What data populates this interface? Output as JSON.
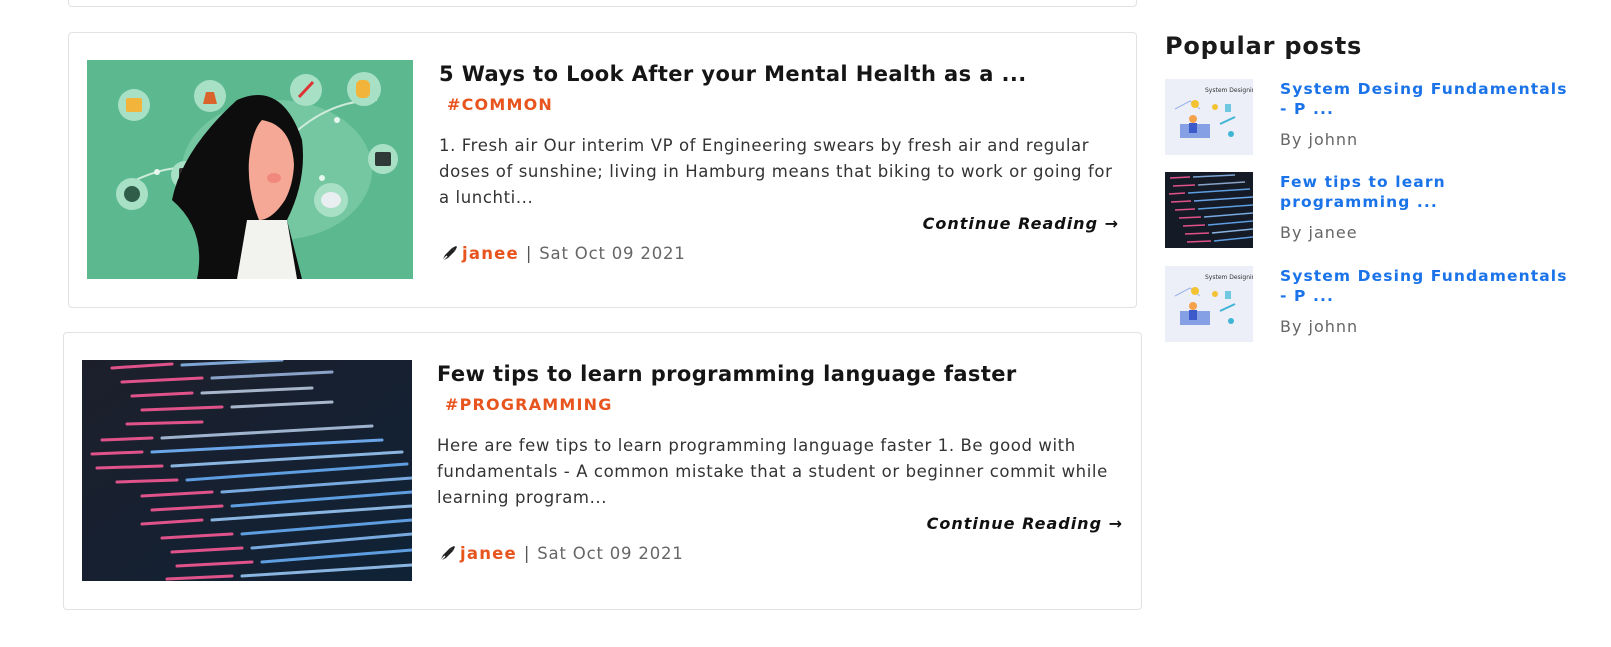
{
  "posts": [
    {
      "title": "5 Ways to Look After your Mental Health as a ...",
      "tag": "#COMMON",
      "excerpt": "1. Fresh air Our interim VP of Engineering swears by fresh air and regular doses of sunshine; living in Hamburg means that biking to work or going for a lunchti...",
      "continue": "Continue Reading →",
      "author": "janee",
      "separator": "|",
      "date": "Sat Oct 09 2021",
      "image": "mental-health-illustration"
    },
    {
      "title": "Few tips to learn programming language faster",
      "tag": "#PROGRAMMING",
      "excerpt": "Here are few tips to learn programming language faster 1. Be good with fundamentals - A common mistake that a student or beginner commit while learning program...",
      "continue": "Continue Reading →",
      "author": "janee",
      "separator": "|",
      "date": "Sat Oct 09 2021",
      "image": "code-screenshot"
    }
  ],
  "sidebar": {
    "title": "Popular posts",
    "items": [
      {
        "title": "System Desing Fundamentals - P ...",
        "author": "By johnn",
        "image": "system-design-illustration"
      },
      {
        "title": "Few tips to learn programming ...",
        "author": "By janee",
        "image": "code-screenshot"
      },
      {
        "title": "System Desing Fundamentals - P ...",
        "author": "By johnn",
        "image": "system-design-illustration"
      }
    ]
  },
  "colors": {
    "accent": "#e8541e",
    "link": "#1a73e8",
    "card_border": "#e2e2e2",
    "mental_bg": "#5cb98f"
  }
}
